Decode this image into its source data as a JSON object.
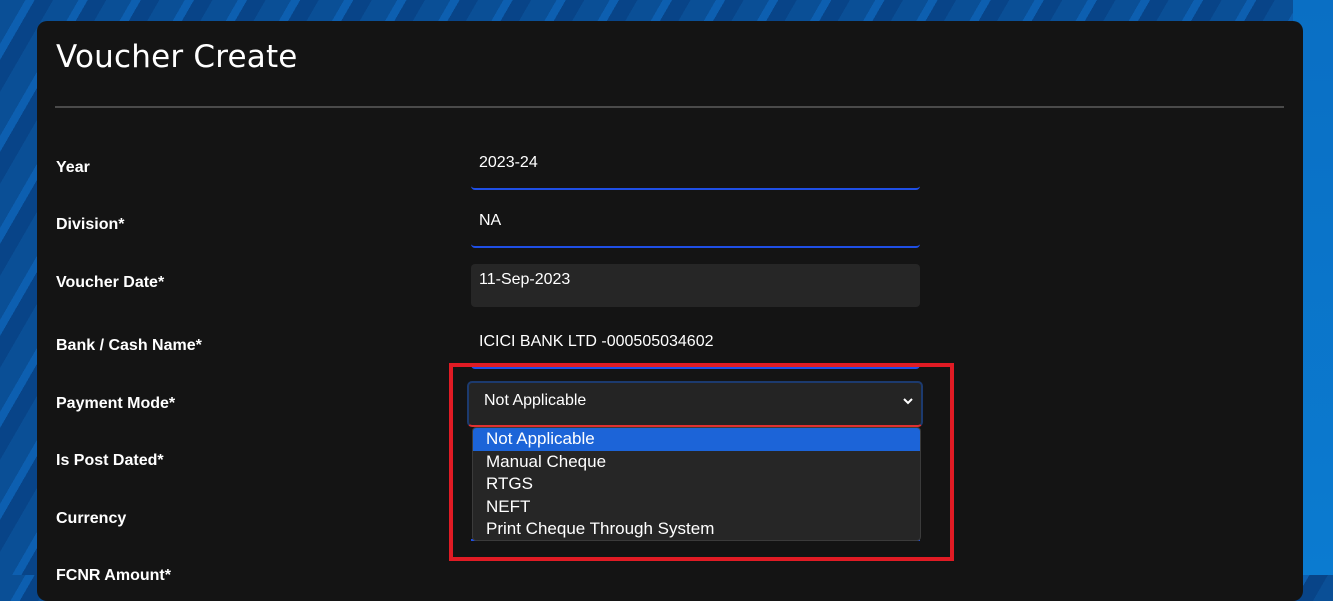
{
  "page": {
    "title": "Voucher Create"
  },
  "form": {
    "year": {
      "label": "Year",
      "value": "2023-24"
    },
    "division": {
      "label": "Division*",
      "value": "NA"
    },
    "voucher_date": {
      "label": "Voucher Date*",
      "value": "11-Sep-2023"
    },
    "bank_cash_name": {
      "label": "Bank / Cash Name*",
      "value": "ICICI BANK LTD -000505034602"
    },
    "payment_mode": {
      "label": "Payment Mode*",
      "value": "Not Applicable",
      "options": [
        "Not Applicable",
        "Manual Cheque",
        "RTGS",
        "NEFT",
        "Print Cheque Through System"
      ]
    },
    "is_post_dated": {
      "label": "Is Post Dated*"
    },
    "currency": {
      "label": "Currency"
    },
    "fcnr_amount": {
      "label": "FCNR Amount*"
    }
  },
  "colors": {
    "highlight": "#e01b24",
    "selected_option": "#1c64d8",
    "field_underline": "#1f4fe6"
  },
  "icons": {
    "select_chevron": "chevron-down-icon"
  }
}
